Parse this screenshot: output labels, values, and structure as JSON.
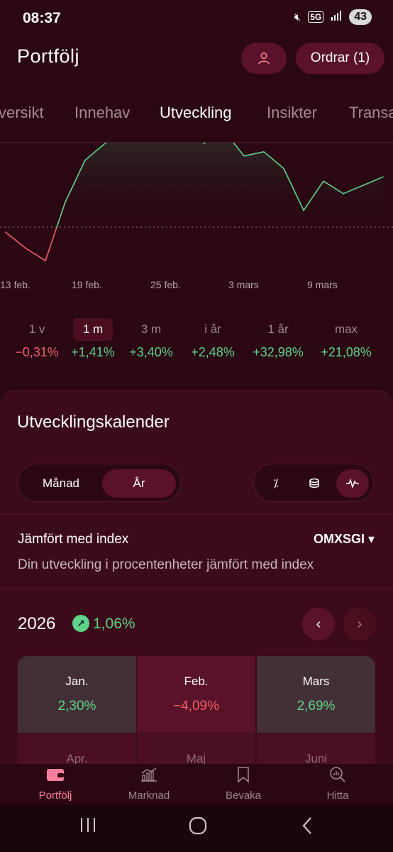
{
  "status": {
    "time": "08:37",
    "battery": "43"
  },
  "header": {
    "title": "Portfölj",
    "orders_label": "Ordrar (1)"
  },
  "tabs": [
    {
      "label": "versikt"
    },
    {
      "label": "Innehav"
    },
    {
      "label": "Utveckling"
    },
    {
      "label": "Insikter"
    },
    {
      "label": "Transa"
    }
  ],
  "chart_data": {
    "type": "line",
    "x_ticks": [
      "13 feb.",
      "19 feb.",
      "25 feb.",
      "3 mars",
      "9 mars"
    ],
    "x": [
      1,
      2,
      3,
      4,
      5,
      6,
      7,
      8,
      9,
      10,
      11,
      12,
      13,
      14,
      15,
      16,
      17,
      18,
      19,
      20
    ],
    "values": [
      -0.6,
      -2.5,
      -4.0,
      3.0,
      8.0,
      10.0,
      12.0,
      12.5,
      12.5,
      12.0,
      10.0,
      11.5,
      8.5,
      9.0,
      7.0,
      2.0,
      5.5,
      4.0,
      5.0,
      6.0
    ],
    "baseline": 0,
    "colors": {
      "positive": "#5fd38a",
      "negative": "#f0606a"
    }
  },
  "periods": [
    {
      "label": "1 v",
      "value": "−0,31%",
      "sign": "neg"
    },
    {
      "label": "1 m",
      "value": "+1,41%",
      "sign": "pos",
      "active": true
    },
    {
      "label": "3 m",
      "value": "+3,40%",
      "sign": "pos"
    },
    {
      "label": "i år",
      "value": "+2,48%",
      "sign": "pos"
    },
    {
      "label": "1 år",
      "value": "+32,98%",
      "sign": "pos"
    },
    {
      "label": "max",
      "value": "+21,08%",
      "sign": "pos"
    }
  ],
  "calendar": {
    "title": "Utvecklingskalender",
    "seg_month": "Månad",
    "seg_year": "År",
    "icons": [
      "percent-icon",
      "coins-icon",
      "pulse-icon"
    ],
    "compare_title": "Jämfört med index",
    "compare_index": "OMXSGI ▾",
    "compare_desc": "Din utveckling i procentenheter jämfört med index",
    "year": "2026",
    "year_change": "1,06%",
    "months": [
      {
        "name": "Jan.",
        "value": "2,30%",
        "sign": "pos"
      },
      {
        "name": "Feb.",
        "value": "−4,09%",
        "sign": "neg"
      },
      {
        "name": "Mars",
        "value": "2,69%",
        "sign": "pos"
      },
      {
        "name": "Apr.",
        "value": "",
        "sign": "none"
      },
      {
        "name": "Maj",
        "value": "",
        "sign": "none"
      },
      {
        "name": "Juni",
        "value": "",
        "sign": "none"
      }
    ]
  },
  "bottom_nav": [
    {
      "label": "Portfölj",
      "icon": "wallet-icon",
      "active": true
    },
    {
      "label": "Marknad",
      "icon": "chart-icon"
    },
    {
      "label": "Bevaka",
      "icon": "bookmark-icon"
    },
    {
      "label": "Hitta",
      "icon": "search-chart-icon"
    }
  ]
}
